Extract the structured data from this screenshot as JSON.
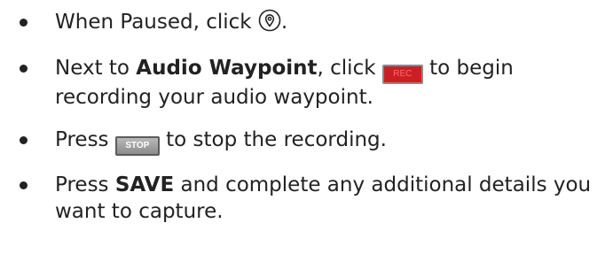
{
  "instructions": {
    "step1": {
      "text_before": "When Paused, click ",
      "text_after": ".",
      "icon": "location-pin-icon"
    },
    "step2": {
      "text_before": "Next to ",
      "bold": "Audio Waypoint",
      "text_middle": ", click ",
      "button_label": "REC",
      "text_after": " to begin recording your audio waypoint."
    },
    "step3": {
      "text_before": "Press ",
      "button_label": "STOP",
      "text_after": " to stop the recording."
    },
    "step4": {
      "text_before": "Press ",
      "bold": "SAVE",
      "text_after": " and complete any additional details you want to capture."
    }
  },
  "colors": {
    "text": "#222222",
    "rec_button": "#cc1f24",
    "stop_button": "#9a9a9a"
  }
}
